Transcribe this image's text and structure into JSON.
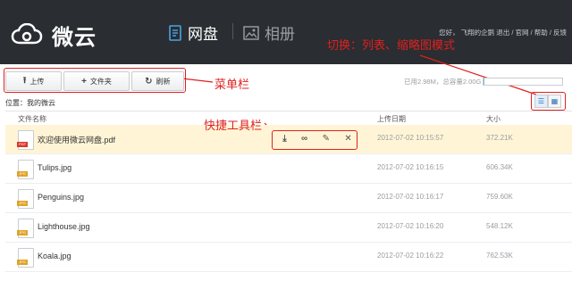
{
  "header": {
    "logo_text": "微云",
    "tabs": [
      {
        "label": "网盘",
        "active": true
      },
      {
        "label": "相册",
        "active": false
      }
    ],
    "user_links": "您好， 飞翔的企鹅 退出 / 官网 / 帮助 / 反馈"
  },
  "annotations": {
    "switch_view": "切换：列表、缩略图模式",
    "menu_bar": "菜单栏",
    "quick_toolbar": "快捷工具栏"
  },
  "toolbar": {
    "upload_label": "上传",
    "folder_label": "文件夹",
    "refresh_label": "刷新"
  },
  "quota": {
    "text": "已用2.98M，总容量2.00G",
    "used_fraction": 0.0015
  },
  "breadcrumb": {
    "text": "位置：我的微云"
  },
  "table": {
    "headers": {
      "name": "文件名称",
      "date": "上传日期",
      "size": "大小"
    },
    "rows": [
      {
        "name": "欢迎使用微云网盘.pdf",
        "date": "2012-07-02 10:15:57",
        "size": "372.21K",
        "type": "PDF"
      },
      {
        "name": "Tulips.jpg",
        "date": "2012-07-02 10:16:15",
        "size": "606.34K",
        "type": "JPG"
      },
      {
        "name": "Penguins.jpg",
        "date": "2012-07-02 10:16:17",
        "size": "759.60K",
        "type": "JPG"
      },
      {
        "name": "Lighthouse.jpg",
        "date": "2012-07-02 10:16:20",
        "size": "548.12K",
        "type": "JPG"
      },
      {
        "name": "Koala.jpg",
        "date": "2012-07-02 10:16:22",
        "size": "762.53K",
        "type": "JPG"
      }
    ]
  },
  "colors": {
    "topbar": "#2a2d31",
    "accent": "#4aa3e8",
    "annotation": "#e02020",
    "selected_row": "#fff5d6",
    "pdf_badge": "#d9382a",
    "jpg_badge": "#e0a228"
  }
}
